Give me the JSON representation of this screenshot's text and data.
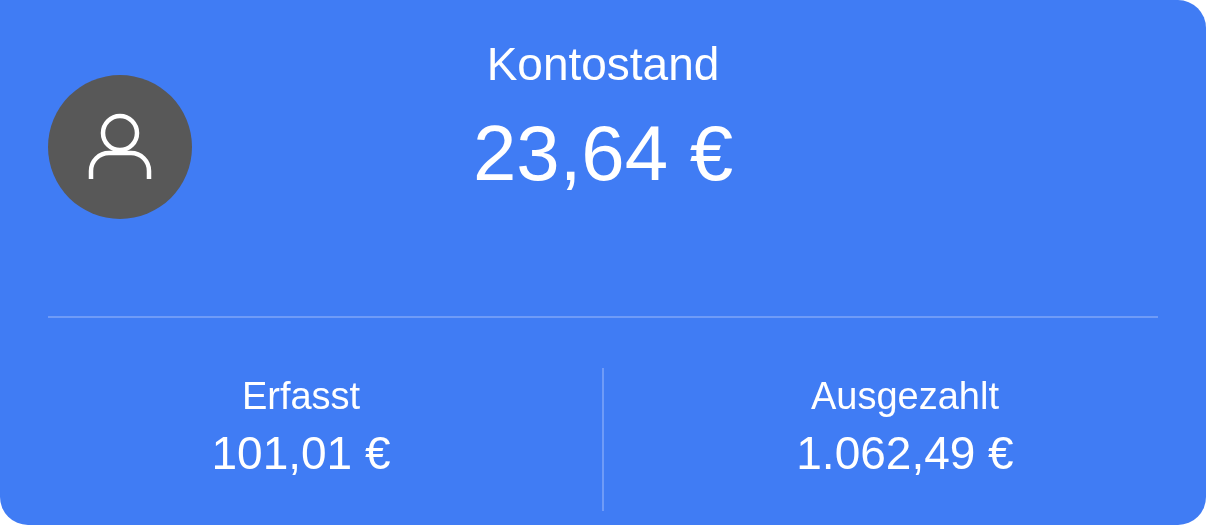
{
  "balance": {
    "label": "Kontostand",
    "amount": "23,64 €"
  },
  "stats": [
    {
      "label": "Erfasst",
      "value": "101,01 €"
    },
    {
      "label": "Ausgezahlt",
      "value": "1.062,49 €"
    }
  ]
}
